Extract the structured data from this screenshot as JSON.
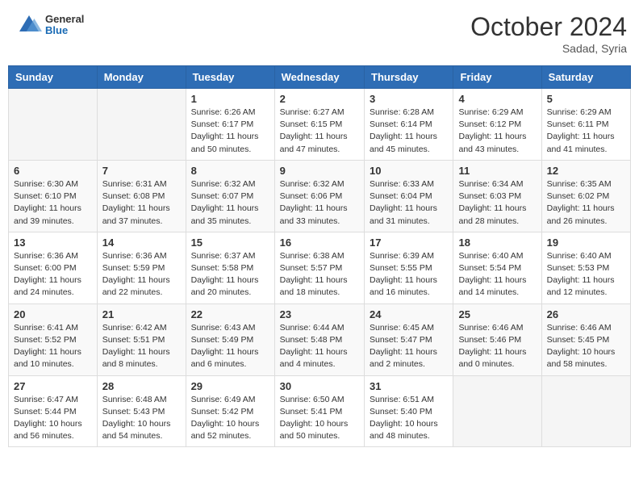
{
  "logo": {
    "general": "General",
    "blue": "Blue"
  },
  "header": {
    "month": "October 2024",
    "location": "Sadad, Syria"
  },
  "days_of_week": [
    "Sunday",
    "Monday",
    "Tuesday",
    "Wednesday",
    "Thursday",
    "Friday",
    "Saturday"
  ],
  "weeks": [
    [
      {
        "day": "",
        "sunrise": "",
        "sunset": "",
        "daylight": ""
      },
      {
        "day": "",
        "sunrise": "",
        "sunset": "",
        "daylight": ""
      },
      {
        "day": "1",
        "sunrise": "Sunrise: 6:26 AM",
        "sunset": "Sunset: 6:17 PM",
        "daylight": "Daylight: 11 hours and 50 minutes."
      },
      {
        "day": "2",
        "sunrise": "Sunrise: 6:27 AM",
        "sunset": "Sunset: 6:15 PM",
        "daylight": "Daylight: 11 hours and 47 minutes."
      },
      {
        "day": "3",
        "sunrise": "Sunrise: 6:28 AM",
        "sunset": "Sunset: 6:14 PM",
        "daylight": "Daylight: 11 hours and 45 minutes."
      },
      {
        "day": "4",
        "sunrise": "Sunrise: 6:29 AM",
        "sunset": "Sunset: 6:12 PM",
        "daylight": "Daylight: 11 hours and 43 minutes."
      },
      {
        "day": "5",
        "sunrise": "Sunrise: 6:29 AM",
        "sunset": "Sunset: 6:11 PM",
        "daylight": "Daylight: 11 hours and 41 minutes."
      }
    ],
    [
      {
        "day": "6",
        "sunrise": "Sunrise: 6:30 AM",
        "sunset": "Sunset: 6:10 PM",
        "daylight": "Daylight: 11 hours and 39 minutes."
      },
      {
        "day": "7",
        "sunrise": "Sunrise: 6:31 AM",
        "sunset": "Sunset: 6:08 PM",
        "daylight": "Daylight: 11 hours and 37 minutes."
      },
      {
        "day": "8",
        "sunrise": "Sunrise: 6:32 AM",
        "sunset": "Sunset: 6:07 PM",
        "daylight": "Daylight: 11 hours and 35 minutes."
      },
      {
        "day": "9",
        "sunrise": "Sunrise: 6:32 AM",
        "sunset": "Sunset: 6:06 PM",
        "daylight": "Daylight: 11 hours and 33 minutes."
      },
      {
        "day": "10",
        "sunrise": "Sunrise: 6:33 AM",
        "sunset": "Sunset: 6:04 PM",
        "daylight": "Daylight: 11 hours and 31 minutes."
      },
      {
        "day": "11",
        "sunrise": "Sunrise: 6:34 AM",
        "sunset": "Sunset: 6:03 PM",
        "daylight": "Daylight: 11 hours and 28 minutes."
      },
      {
        "day": "12",
        "sunrise": "Sunrise: 6:35 AM",
        "sunset": "Sunset: 6:02 PM",
        "daylight": "Daylight: 11 hours and 26 minutes."
      }
    ],
    [
      {
        "day": "13",
        "sunrise": "Sunrise: 6:36 AM",
        "sunset": "Sunset: 6:00 PM",
        "daylight": "Daylight: 11 hours and 24 minutes."
      },
      {
        "day": "14",
        "sunrise": "Sunrise: 6:36 AM",
        "sunset": "Sunset: 5:59 PM",
        "daylight": "Daylight: 11 hours and 22 minutes."
      },
      {
        "day": "15",
        "sunrise": "Sunrise: 6:37 AM",
        "sunset": "Sunset: 5:58 PM",
        "daylight": "Daylight: 11 hours and 20 minutes."
      },
      {
        "day": "16",
        "sunrise": "Sunrise: 6:38 AM",
        "sunset": "Sunset: 5:57 PM",
        "daylight": "Daylight: 11 hours and 18 minutes."
      },
      {
        "day": "17",
        "sunrise": "Sunrise: 6:39 AM",
        "sunset": "Sunset: 5:55 PM",
        "daylight": "Daylight: 11 hours and 16 minutes."
      },
      {
        "day": "18",
        "sunrise": "Sunrise: 6:40 AM",
        "sunset": "Sunset: 5:54 PM",
        "daylight": "Daylight: 11 hours and 14 minutes."
      },
      {
        "day": "19",
        "sunrise": "Sunrise: 6:40 AM",
        "sunset": "Sunset: 5:53 PM",
        "daylight": "Daylight: 11 hours and 12 minutes."
      }
    ],
    [
      {
        "day": "20",
        "sunrise": "Sunrise: 6:41 AM",
        "sunset": "Sunset: 5:52 PM",
        "daylight": "Daylight: 11 hours and 10 minutes."
      },
      {
        "day": "21",
        "sunrise": "Sunrise: 6:42 AM",
        "sunset": "Sunset: 5:51 PM",
        "daylight": "Daylight: 11 hours and 8 minutes."
      },
      {
        "day": "22",
        "sunrise": "Sunrise: 6:43 AM",
        "sunset": "Sunset: 5:49 PM",
        "daylight": "Daylight: 11 hours and 6 minutes."
      },
      {
        "day": "23",
        "sunrise": "Sunrise: 6:44 AM",
        "sunset": "Sunset: 5:48 PM",
        "daylight": "Daylight: 11 hours and 4 minutes."
      },
      {
        "day": "24",
        "sunrise": "Sunrise: 6:45 AM",
        "sunset": "Sunset: 5:47 PM",
        "daylight": "Daylight: 11 hours and 2 minutes."
      },
      {
        "day": "25",
        "sunrise": "Sunrise: 6:46 AM",
        "sunset": "Sunset: 5:46 PM",
        "daylight": "Daylight: 11 hours and 0 minutes."
      },
      {
        "day": "26",
        "sunrise": "Sunrise: 6:46 AM",
        "sunset": "Sunset: 5:45 PM",
        "daylight": "Daylight: 10 hours and 58 minutes."
      }
    ],
    [
      {
        "day": "27",
        "sunrise": "Sunrise: 6:47 AM",
        "sunset": "Sunset: 5:44 PM",
        "daylight": "Daylight: 10 hours and 56 minutes."
      },
      {
        "day": "28",
        "sunrise": "Sunrise: 6:48 AM",
        "sunset": "Sunset: 5:43 PM",
        "daylight": "Daylight: 10 hours and 54 minutes."
      },
      {
        "day": "29",
        "sunrise": "Sunrise: 6:49 AM",
        "sunset": "Sunset: 5:42 PM",
        "daylight": "Daylight: 10 hours and 52 minutes."
      },
      {
        "day": "30",
        "sunrise": "Sunrise: 6:50 AM",
        "sunset": "Sunset: 5:41 PM",
        "daylight": "Daylight: 10 hours and 50 minutes."
      },
      {
        "day": "31",
        "sunrise": "Sunrise: 6:51 AM",
        "sunset": "Sunset: 5:40 PM",
        "daylight": "Daylight: 10 hours and 48 minutes."
      },
      {
        "day": "",
        "sunrise": "",
        "sunset": "",
        "daylight": ""
      },
      {
        "day": "",
        "sunrise": "",
        "sunset": "",
        "daylight": ""
      }
    ]
  ]
}
